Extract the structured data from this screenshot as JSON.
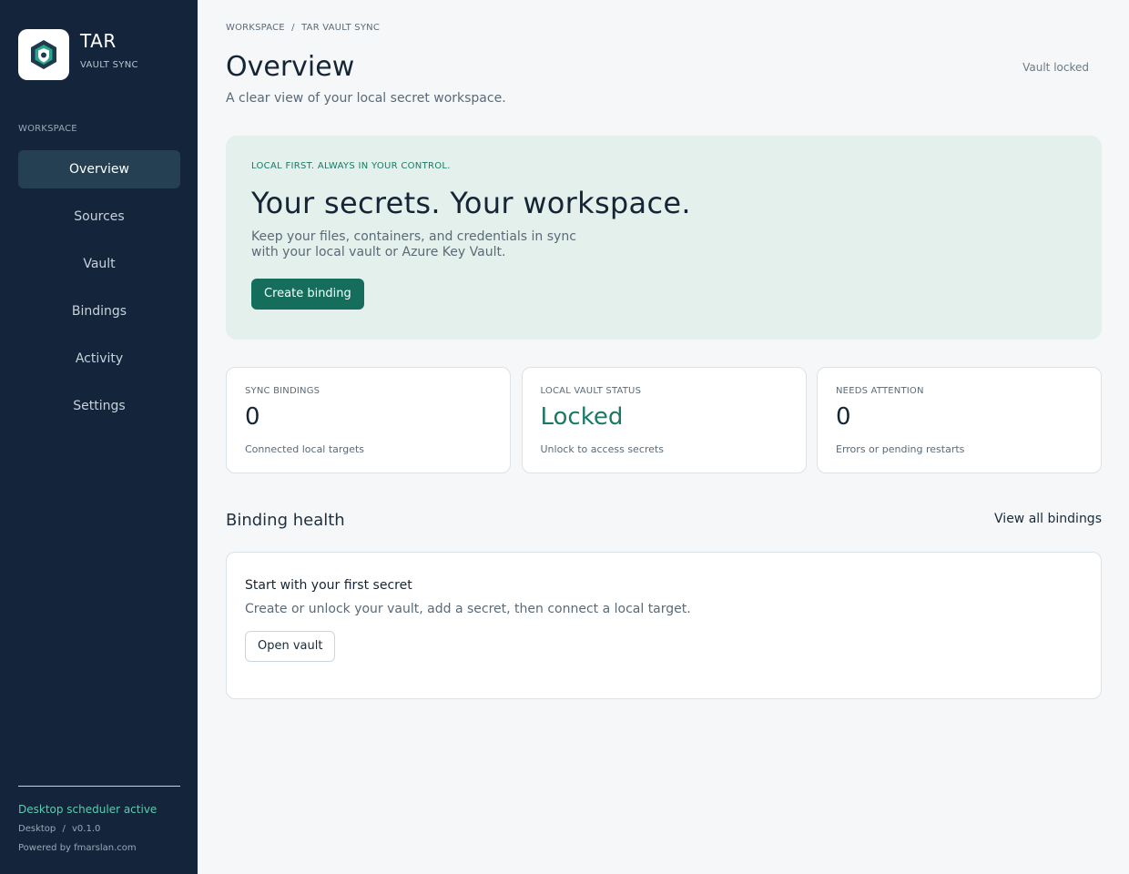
{
  "brand": {
    "name": "TAR",
    "subtitle": "VAULT SYNC",
    "logo_icon": "shield-hexagon-icon",
    "logo_colors": [
      "#1f3a4d",
      "#2aa58c",
      "#ffffff"
    ]
  },
  "sidebar": {
    "section_label": "WORKSPACE",
    "items": [
      {
        "label": "Overview",
        "active": true
      },
      {
        "label": "Sources",
        "active": false
      },
      {
        "label": "Vault",
        "active": false
      },
      {
        "label": "Bindings",
        "active": false
      },
      {
        "label": "Activity",
        "active": false
      },
      {
        "label": "Settings",
        "active": false
      }
    ],
    "footer": {
      "scheduler_status": "Desktop scheduler active",
      "platform": "Desktop",
      "version": "v0.1.0",
      "powered_by": "Powered by fmarslan.com"
    }
  },
  "header": {
    "breadcrumb": [
      "WORKSPACE",
      "TAR VAULT SYNC"
    ],
    "breadcrumb_separator": "/",
    "title": "Overview",
    "subtitle": "A clear view of your local secret workspace.",
    "vault_status": "Vault locked"
  },
  "hero": {
    "eyebrow": "LOCAL FIRST. ALWAYS IN YOUR CONTROL.",
    "title": "Your secrets. Your workspace.",
    "text": "Keep your files, containers, and credentials in sync with your local vault or Azure Key Vault.",
    "button_label": "Create binding"
  },
  "stats": [
    {
      "label": "SYNC BINDINGS",
      "value": "0",
      "note": "Connected local targets"
    },
    {
      "label": "LOCAL VAULT STATUS",
      "value": "Locked",
      "note": "Unlock to access secrets"
    },
    {
      "label": "NEEDS ATTENTION",
      "value": "0",
      "note": "Errors or pending restarts"
    }
  ],
  "binding_health": {
    "title": "Binding health",
    "view_all_label": "View all bindings",
    "empty_title": "Start with your first secret",
    "empty_text": "Create or unlock your vault, add a secret, then connect a local target.",
    "button_label": "Open vault"
  },
  "colors": {
    "sidebar_bg": "#14243a",
    "nav_active_bg": "#254052",
    "accent": "#156d5c",
    "accent_text": "#1a7a66",
    "hero_bg": "#e3f0ec",
    "scheduler_green": "#5fcab1",
    "page_bg": "#f5f7f9"
  }
}
